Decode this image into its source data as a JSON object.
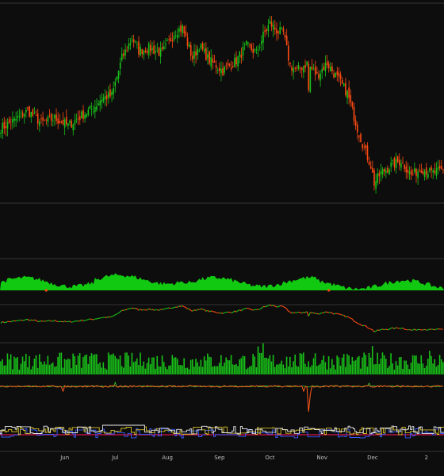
{
  "chart_data": {
    "type": "candlestick",
    "title": "",
    "colors": {
      "background": "#0d0d0d",
      "grid": "#2a2a2a",
      "separator": "#353535",
      "up": "#19c219",
      "down": "#ff4a12",
      "area": "#12c912",
      "volume": "#18c018",
      "line_fast": "#ff5a1a",
      "line_slow": "#2fbf2f",
      "step_a": "#e9e9e9",
      "step_b": "#d8c02a",
      "step_c": "#3a5cff",
      "baseline": "#d4144a",
      "axis_text": "#bdbdbd"
    },
    "x_axis": {
      "months": [
        "Jun",
        "Jul",
        "Aug",
        "Sep",
        "Oct",
        "Nov",
        "Dec",
        "2"
      ],
      "range_days": 264,
      "month_day_index": [
        38,
        68,
        99,
        130,
        160,
        191,
        221,
        253
      ]
    },
    "close_path": [
      [
        0,
        100
      ],
      [
        8,
        103
      ],
      [
        16,
        107
      ],
      [
        24,
        102
      ],
      [
        32,
        104
      ],
      [
        40,
        101
      ],
      [
        48,
        105
      ],
      [
        55,
        108
      ],
      [
        60,
        112
      ],
      [
        66,
        113
      ],
      [
        72,
        128
      ],
      [
        78,
        136
      ],
      [
        82,
        131
      ],
      [
        88,
        132
      ],
      [
        96,
        130
      ],
      [
        104,
        139
      ],
      [
        108,
        140
      ],
      [
        114,
        128
      ],
      [
        118,
        133
      ],
      [
        124,
        127
      ],
      [
        132,
        123
      ],
      [
        140,
        127
      ],
      [
        146,
        133
      ],
      [
        152,
        130
      ],
      [
        156,
        137
      ],
      [
        160,
        142
      ],
      [
        164,
        139
      ],
      [
        168,
        138
      ],
      [
        172,
        125
      ],
      [
        176,
        123
      ],
      [
        182,
        126
      ],
      [
        188,
        121
      ],
      [
        194,
        126
      ],
      [
        200,
        120
      ],
      [
        206,
        114
      ],
      [
        212,
        100
      ],
      [
        216,
        92
      ],
      [
        220,
        85
      ],
      [
        222,
        78
      ],
      [
        226,
        82
      ],
      [
        232,
        85
      ],
      [
        238,
        87
      ],
      [
        244,
        81
      ],
      [
        250,
        84
      ],
      [
        256,
        82
      ],
      [
        263,
        83
      ]
    ],
    "price_ylim": [
      70,
      150
    ],
    "volume_ylim": [
      0,
      100
    ],
    "step_ylim": [
      0,
      100
    ]
  }
}
